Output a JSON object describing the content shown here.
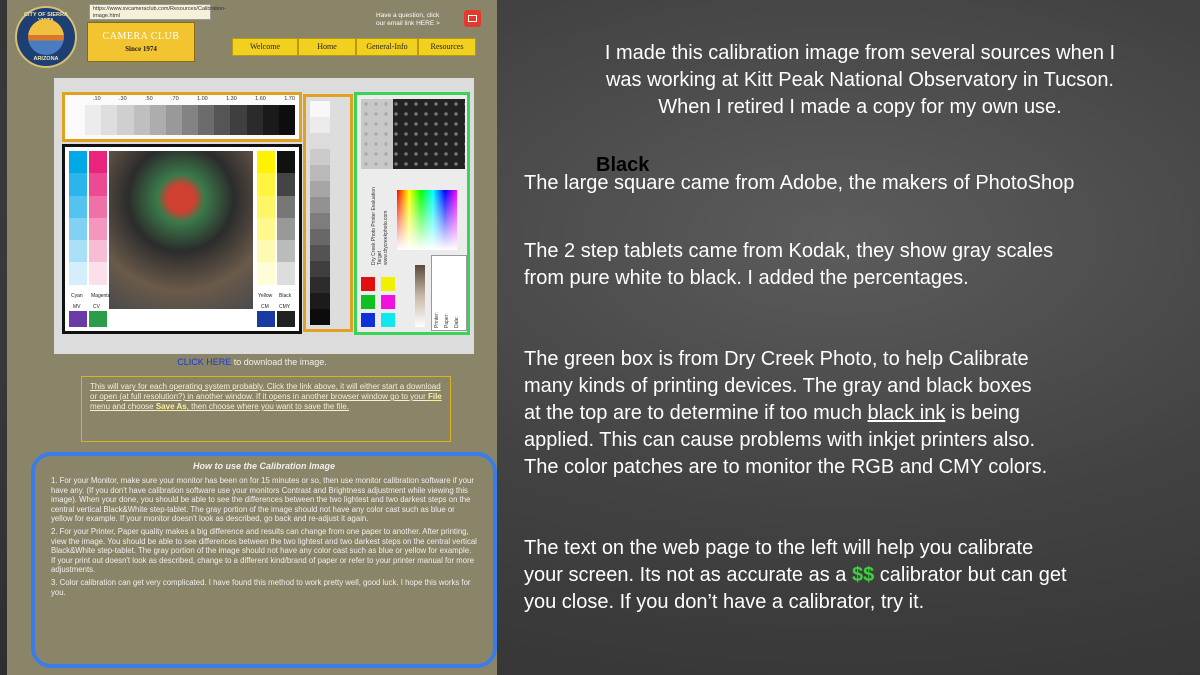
{
  "webpage": {
    "url_tooltip": "https://www.svcameraclub.com/Resources/Calibration-image.html",
    "seal": {
      "text_top": "CITY OF SIERRA VISTA",
      "text_bottom": "ARIZONA"
    },
    "club": {
      "name": "CAMERA CLUB",
      "since": "Since 1974"
    },
    "contact": {
      "line1": "Have a question, click",
      "line2": "our email link  HERE >"
    },
    "nav": [
      "Welcome",
      "Home",
      "General-Info",
      "Resources"
    ],
    "download": {
      "link": "CLICK HERE",
      "rest": " to download the image."
    },
    "note": {
      "part1": "This will vary for each operating system probably. Click the link above, it will either start a download or open (at full resolution?) in another window.  If it opens in another browser window go to your ",
      "file": "File",
      "part2": " menu and choose ",
      "save_as": "Save As",
      "part3": ", then choose where you want to save the file."
    },
    "howto": {
      "title": "How to use the Calibration Image",
      "p1": "1.  For your Monitor, make sure your monitor has been on for 15 minutes or so, then use monitor calibration software if your have any.  (If you don't have calibration software use your monitors Contrast and Brightness adjustment while viewing this image).  When your done, you should be able to see the differences between the two lightest and two darkest steps on the central vertical Black&White step-tablet.  The gray portion of the image should not have any color cast such as blue or yellow for example.  If your monitor doesn't look as described, go back and re-adjust it again.",
      "p2": "2.  For your Printer,  Paper quality makes a big difference and results can change from one paper to another.  After printing, view the image.  You should be able to see differences between the two lightest and two darkest steps on the central vertical Black&White step-tablet.  The gray portion of the image should not have any color cast such as blue or yellow for example.  If your print out doesn't look as described, change to a different kind/brand of paper or refer to your printer manual for more adjustments.",
      "p3": "3.  Color calibration can get very complicated.  I have found this method to work pretty well, good luck.  I hope this works for you."
    },
    "step_labels": [
      ".10",
      ".30",
      ".50",
      ".70",
      "1.00",
      "1.30",
      "1.60",
      "1.70"
    ],
    "adobe_labels": {
      "cyan": "Cyan",
      "magenta": "Magenta",
      "yellow": "Yellow",
      "black": "Black",
      "mv": "MV",
      "cv": "CV",
      "cm": "CM",
      "cmy": "CMY"
    },
    "green_box_text": {
      "title": "Dry Creek Photo Printer Evaluation Target",
      "url": "www.drycreekphoto.com",
      "printer": "Printer:",
      "paper": "Paper:",
      "date": "Date:"
    }
  },
  "slide": {
    "intro": [
      "I made this calibration image from several sources when I",
      "was working at Kitt Peak National Observatory in Tucson.",
      "When I retired I made a copy for my own use."
    ],
    "black_label": "Black",
    "adobe": "The large square came from Adobe, the makers of PhotoShop",
    "kodak": [
      "The 2 step tablets came from Kodak, they show gray scales",
      "from pure white to black. I added the percentages."
    ],
    "green": {
      "line1": "The green box is from Dry Creek Photo, to help Calibrate",
      "line2": "many kinds of printing devices.  The gray and black boxes",
      "line3_pre": "at the top are to determine if too much ",
      "line3_link": "black ink",
      "line3_post": " is being",
      "line4": "applied. This can cause problems with inkjet printers also.",
      "line5": "The color patches are to monitor the RGB and CMY colors."
    },
    "webtext": {
      "line1": "The text on the web page to the left will help you calibrate",
      "line2_pre": "your screen.  Its not as accurate as a ",
      "line2_money": "$$",
      "line2_post": " calibrator but can get",
      "line3": "you close.  If you don’t have a calibrator, try it."
    }
  }
}
